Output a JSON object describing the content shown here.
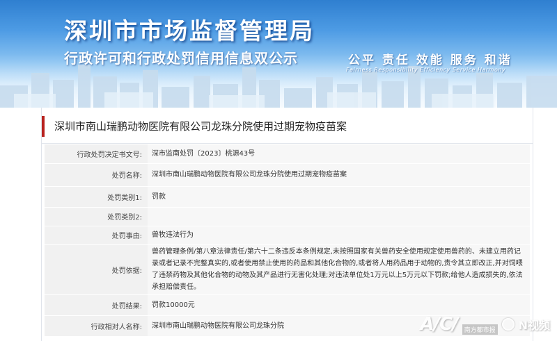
{
  "header": {
    "title": "深圳市市场监督管理局",
    "subtitle": "行政许可和行政处罚信用信息双公示",
    "slogan": "公平 责任 效能 服务 和谐",
    "slogan_en": "Fairness Responsibility Efficiency Service Harmony"
  },
  "case": {
    "title": "深圳市南山瑞鹏动物医院有限公司龙珠分院使用过期宠物疫苗案"
  },
  "fields": [
    {
      "label": "行政处罚决定书文号:",
      "value": "深市监南处罚〔2023〕桃源43号"
    },
    {
      "label": "处罚名称:",
      "value": "深圳市南山瑞鹏动物医院有限公司龙珠分院使用过期宠物疫苗案"
    },
    {
      "label": "处罚类别1:",
      "value": "罚款"
    },
    {
      "label": "处罚类别2:",
      "value": ""
    },
    {
      "label": "处罚事由:",
      "value": "兽牧违法行为"
    },
    {
      "label": "处罚依据:",
      "value": "兽药管理条例/第八章法律责任/第六十二条违反本条例规定,未按照国家有关兽药安全使用规定使用兽药的、未建立用药记录或者记录不完整真实的,或者使用禁止使用的药品和其他化合物的,或者将人用药品用于动物的,责令其立即改正,并对饲喂了违禁药物及其他化合物的动物及其产品进行无害化处理;对违法单位处1万元以上5万元以下罚款;给他人造成损失的,依法承担赔偿责任。"
    },
    {
      "label": "处罚结果:",
      "value": "罚款10000元"
    },
    {
      "label": "行政相对人名称:",
      "value": "深圳市南山瑞鹏动物医院有限公司龙珠分院"
    }
  ],
  "watermark": {
    "mark": "A/C/",
    "sub": "南方都市报",
    "n": "N视频"
  },
  "colors": {
    "accent": "#b8221f",
    "banner_top": "#2f7fd0",
    "label_bg": "#f1f1f1",
    "value_bg": "#f7f7f7"
  }
}
